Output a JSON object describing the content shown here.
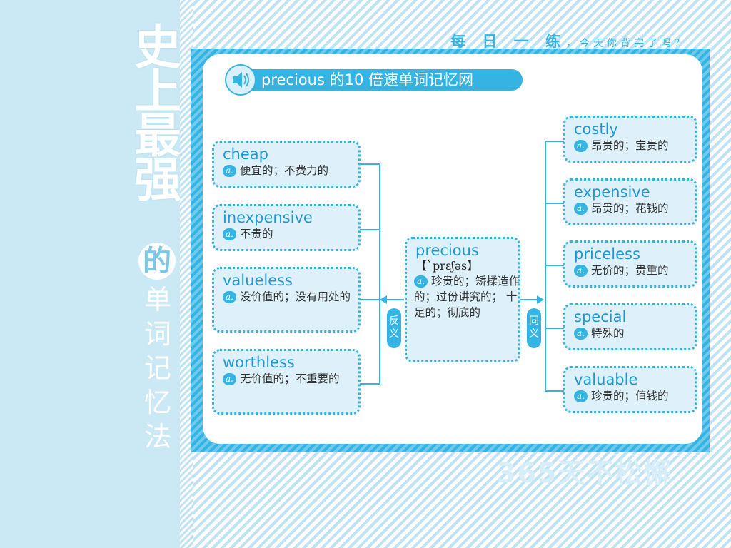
{
  "header": {
    "slogan_main": "每 日 一 练",
    "slogan_sub": "，今天你背完了吗？"
  },
  "sidebar": {
    "title_chars": [
      "史",
      "上",
      "最",
      "强"
    ],
    "de_char": "的",
    "sub_chars": [
      "单",
      "词",
      "记",
      "忆",
      "法"
    ]
  },
  "footer": {
    "slogan": "365天不松懈"
  },
  "title": {
    "word": "precious",
    "rest": " 的10 倍速单词记忆网"
  },
  "pos_badge": "a.",
  "center": {
    "word": "precious",
    "phonetic": "【ˋprɛʃəs】",
    "meaning": "珍贵的；矫揉造作的；过份讲究的； 十足的；彻底的"
  },
  "antonym_tag": "反义",
  "synonym_tag": "同义",
  "antonyms": [
    {
      "word": "cheap",
      "meaning": "便宜的；不费力的"
    },
    {
      "word": "inexpensive",
      "meaning": "不贵的"
    },
    {
      "word": "valueless",
      "meaning": "没价值的；没有用处的"
    },
    {
      "word": "worthless",
      "meaning": "无价值的；不重要的"
    }
  ],
  "synonyms": [
    {
      "word": "costly",
      "meaning": "昂贵的；宝贵的"
    },
    {
      "word": "expensive",
      "meaning": "昂贵的；花钱的"
    },
    {
      "word": "priceless",
      "meaning": "无价的；贵重的"
    },
    {
      "word": "special",
      "meaning": "特殊的"
    },
    {
      "word": "valuable",
      "meaning": "珍贵的；值钱的"
    }
  ]
}
